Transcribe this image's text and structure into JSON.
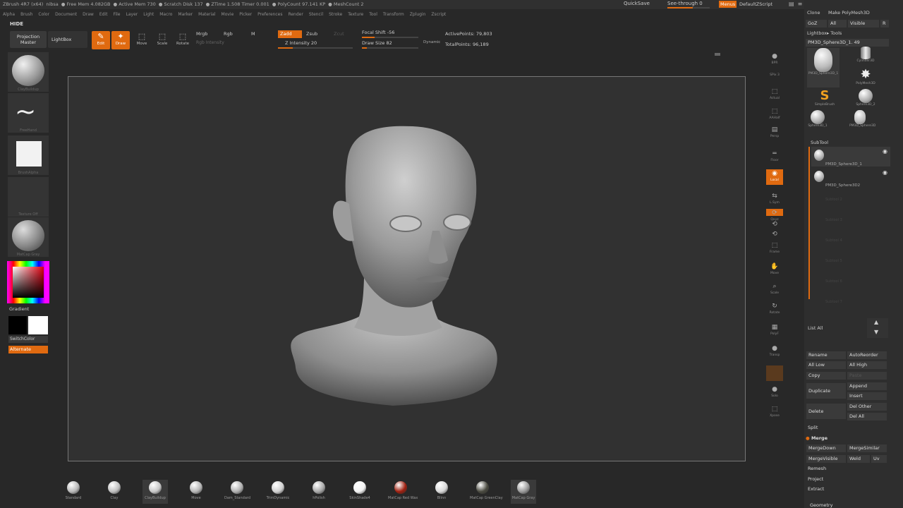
{
  "titlebar": {
    "items": [
      "ZBrush 4R7 (x64)",
      "nibsa",
      "● Free Mem 4.082GB",
      "● Active Mem 730",
      "● Scratch Disk 137",
      "● ZTime 1.508 Timer 0.001",
      "● PolyCount 97.141 KP",
      "● MeshCount 2"
    ]
  },
  "menubar": [
    "Alpha",
    "Brush",
    "Color",
    "Document",
    "Draw",
    "Edit",
    "File",
    "Layer",
    "Light",
    "Macro",
    "Marker",
    "Material",
    "Movie",
    "Picker",
    "Preferences",
    "Render",
    "Stencil",
    "Stroke",
    "Texture",
    "Tool",
    "Transform",
    "Zplugin",
    "Zscript"
  ],
  "topright": {
    "quicksave": "QuickSave",
    "seethrough": "See-through 0",
    "seethrough_value": 0.6,
    "menus": "Menus",
    "defaultzscript": "DefaultZScript"
  },
  "hide": "HIDE",
  "toolbar": {
    "projection_master": "Projection Master",
    "lightbox": "LightBox",
    "edit": "Edit",
    "draw": "Draw",
    "move": "Move",
    "scale": "Scale",
    "rotate": "Rotate",
    "mrgb": "Mrgb",
    "rgb": "Rgb",
    "m": "M",
    "rgb_intensity": "Rgb Intensity",
    "zadd": "Zadd",
    "zsub": "Zsub",
    "zcut": "Zcut",
    "z_intensity": "Z Intensity 20",
    "z_intensity_value": 20,
    "focal_shift": "Focal Shift -56",
    "focal_shift_value": -56,
    "draw_size": "Draw Size 82",
    "draw_size_value": 82,
    "dynamic": "Dynamic",
    "active_points": "ActivePoints: 79,803",
    "total_points": "TotalPoints: 96,189"
  },
  "leftshelf": {
    "brush_label": "ClayBuildup",
    "stroke_label": "FreeHand",
    "alpha_label": "BrushAlpha",
    "texture_label": "Texture Off",
    "material_label": "MatCap Gray",
    "gradient": "Gradient",
    "switchcolor": "SwitchColor",
    "alternate": "Alternate"
  },
  "rightshelf": [
    {
      "name": "bpr",
      "label": "BPR",
      "glyph": "●"
    },
    {
      "name": "spix",
      "label": "SPix 3",
      "glyph": ""
    },
    {
      "name": "actual",
      "label": "Actual",
      "glyph": "⬚"
    },
    {
      "name": "aahalf",
      "label": "AAHalf",
      "glyph": "⬚"
    },
    {
      "name": "persp",
      "label": "Persp",
      "glyph": "▤"
    },
    {
      "name": "floor",
      "label": "Floor",
      "glyph": "═"
    },
    {
      "name": "local",
      "label": "Local",
      "glyph": "◉"
    },
    {
      "name": "lsym",
      "label": "L.Sym",
      "glyph": "⇆"
    },
    {
      "name": "xyz",
      "label": "Qxyz",
      "glyph": "⟳"
    },
    {
      "name": "rot-y",
      "label": "",
      "glyph": "⟲"
    },
    {
      "name": "rot-z",
      "label": "",
      "glyph": "⟲"
    },
    {
      "name": "frame",
      "label": "Frame",
      "glyph": "⬚"
    },
    {
      "name": "move",
      "label": "Move",
      "glyph": "✋"
    },
    {
      "name": "scale",
      "label": "Scale",
      "glyph": "⌕"
    },
    {
      "name": "rotate",
      "label": "Rotate",
      "glyph": "↻"
    },
    {
      "name": "polyf",
      "label": "PolyF",
      "glyph": "▦"
    },
    {
      "name": "transp",
      "label": "Transp",
      "glyph": "●"
    },
    {
      "name": "dynamic",
      "label": "",
      "glyph": ""
    },
    {
      "name": "solo",
      "label": "Solo",
      "glyph": "●"
    },
    {
      "name": "xpose",
      "label": "Xpose",
      "glyph": "⬚"
    }
  ],
  "panel": {
    "clone": "Clone",
    "make_polymesh": "Make PolyMesh3D",
    "goz": "GoZ",
    "all": "All",
    "visible": "Visible",
    "r": "R",
    "lightbox_tools": "Lightbox▸ Tools",
    "current_tool": "PM3D_Sphere3D_1. 49",
    "tools": [
      {
        "label": "PM3D_Sphere3D_1",
        "type": "head"
      },
      {
        "label": "Cylinder3D",
        "type": "cyl"
      },
      {
        "label": "PolyMesh3D",
        "type": "star"
      },
      {
        "label": "SimpleBrush",
        "type": "s"
      },
      {
        "label": "Sphere3D_2",
        "type": "ball"
      },
      {
        "label": "Sphere3D_1",
        "type": "ball"
      },
      {
        "label": "PM3D_Sphere3D",
        "type": "head"
      }
    ],
    "subtool": "SubTool",
    "subtools": [
      "PM3D_Sphere3D_1",
      "PM3D_Sphere3D2"
    ],
    "empty_subtools": [
      "Subtool 2",
      "Subtool 3",
      "Subtool 4",
      "Subtool 5",
      "Subtool 6",
      "Subtool 7"
    ],
    "list_all": "List All",
    "buttons": {
      "rename": "Rename",
      "autoreorder": "AutoReorder",
      "all_low": "All Low",
      "all_high": "All High",
      "copy": "Copy",
      "paste": "Paste",
      "duplicate": "Duplicate",
      "append": "Append",
      "insert": "Insert",
      "delete": "Delete",
      "del_other": "Del Other",
      "del_all": "Del All",
      "split": "Split",
      "merge": "Merge",
      "merge_down": "MergeDown",
      "merge_similar": "MergeSimilar",
      "merge_visible": "MergeVisible",
      "weld": "Weld",
      "uv": "Uv",
      "remesh": "Remesh",
      "project": "Project",
      "extract": "Extract"
    },
    "geometry": "Geometry"
  },
  "brushes": [
    {
      "label": "Standard",
      "color": "#b8b8b8"
    },
    {
      "label": "Clay",
      "color": "#c0c0c0"
    },
    {
      "label": "ClayBuildup",
      "color": "#c8c8c8"
    },
    {
      "label": "Move",
      "color": "#b5b5b5"
    },
    {
      "label": "Dam_Standard",
      "color": "#b0b0b0"
    },
    {
      "label": "TrimDynamic",
      "color": "#d0d0d0"
    },
    {
      "label": "hPolish",
      "color": "#a8a8a8"
    },
    {
      "label": "SkinShade4",
      "color": "#f2f2f2"
    },
    {
      "label": "MatCap Red Wax",
      "color": "#a02010"
    },
    {
      "label": "Blinn",
      "color": "#d8d8d8"
    },
    {
      "label": "MatCap GreenClay",
      "color": "#4a4a40"
    },
    {
      "label": "MatCap Gray",
      "color": "#9a9a9a"
    }
  ],
  "colors": {
    "accent": "#e06a10",
    "background": "#282828",
    "canvas": "#313131"
  }
}
